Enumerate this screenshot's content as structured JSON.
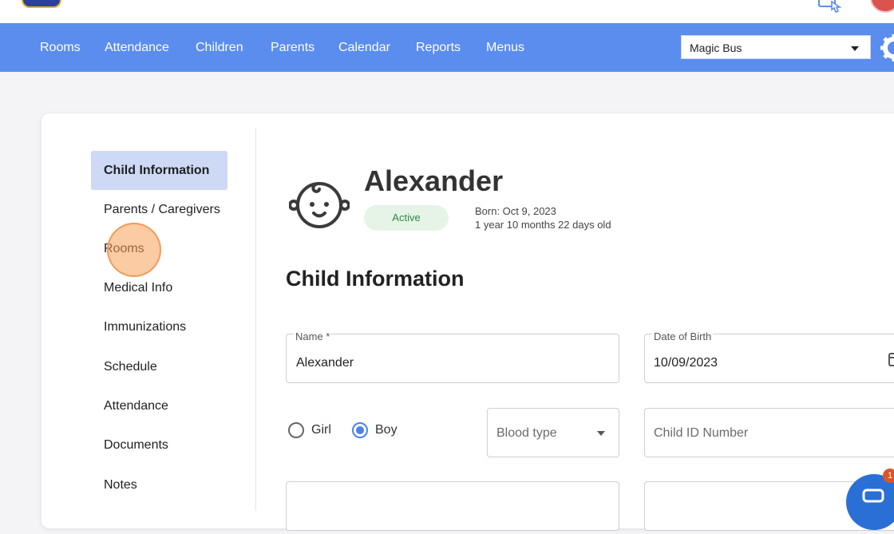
{
  "nav": {
    "items": [
      "Rooms",
      "Attendance",
      "Children",
      "Parents",
      "Calendar",
      "Reports",
      "Menus"
    ],
    "school_select": "Magic Bus"
  },
  "sidebar": {
    "items": [
      "Child Information",
      "Parents / Caregivers",
      "Rooms",
      "Medical Info",
      "Immunizations",
      "Schedule",
      "Attendance",
      "Documents",
      "Notes"
    ],
    "active_index": 0
  },
  "child": {
    "name": "Alexander",
    "status": "Active",
    "born": "Born: Oct 9, 2023",
    "age": "1 year 10 months 22 days old"
  },
  "form": {
    "section_title": "Child Information",
    "name_label": "Name *",
    "name_value": "Alexander",
    "dob_label": "Date of Birth",
    "dob_value": "10/09/2023",
    "gender_options": [
      "Girl",
      "Boy"
    ],
    "gender_selected": "Boy",
    "blood_type_placeholder": "Blood type",
    "child_id_placeholder": "Child ID Number"
  },
  "chat": {
    "badge_count": "1"
  },
  "colors": {
    "nav_bg": "#5b8def",
    "active_bg": "#cdd9f5",
    "status_green": "#2e8b3f",
    "accent_blue": "#4a84e8"
  }
}
